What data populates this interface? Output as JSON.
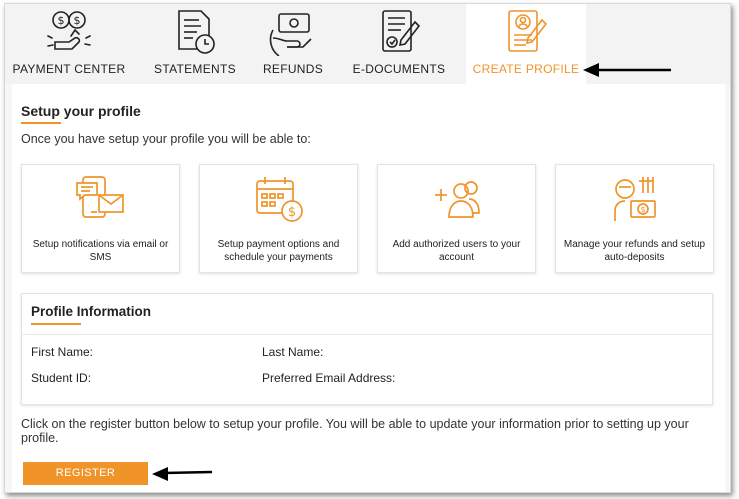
{
  "tabs": [
    {
      "label": "PAYMENT CENTER",
      "icon": "payment-hand-icon",
      "active": false
    },
    {
      "label": "STATEMENTS",
      "icon": "statement-clock-icon",
      "active": false
    },
    {
      "label": "REFUNDS",
      "icon": "refund-hand-icon",
      "active": false
    },
    {
      "label": "E-DOCUMENTS",
      "icon": "document-sign-icon",
      "active": false
    },
    {
      "label": "CREATE PROFILE",
      "icon": "profile-document-icon",
      "active": true
    }
  ],
  "setup": {
    "title": "Setup your profile",
    "intro": "Once you have setup your profile you will be able to:",
    "cards": [
      {
        "text": "Setup notifications via email or SMS",
        "icon": "notifications-icon"
      },
      {
        "text": "Setup payment options and schedule your payments",
        "icon": "payment-schedule-icon"
      },
      {
        "text": "Add authorized users to your account",
        "icon": "add-users-icon"
      },
      {
        "text": "Manage your refunds and setup auto-deposits",
        "icon": "refunds-deposit-icon"
      }
    ]
  },
  "profile": {
    "title": "Profile Information",
    "first_name_label": "First Name:",
    "last_name_label": "Last Name:",
    "student_id_label": "Student ID:",
    "email_label": "Preferred Email Address:"
  },
  "footnote": "Click on the register button below to setup your profile. You will be able to update your information prior to setting up your profile.",
  "register_label": "REGISTER",
  "colors": {
    "accent": "#f0942a",
    "text": "#222222",
    "tab_bg": "#f3f3f3"
  }
}
